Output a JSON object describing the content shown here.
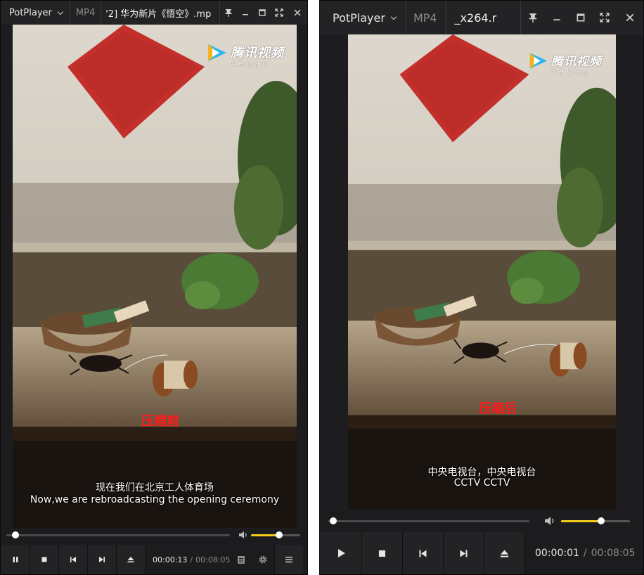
{
  "colors": {
    "accent_volume": "#f2cc1a",
    "note_text": "#ff1a1a",
    "frame_bg": "#1d1d1f"
  },
  "player_left": {
    "app_menu_label": "PotPlayer",
    "tab_format": "MP4",
    "tab_title": "'2] 华为新片《悟空》.mp",
    "watermark_brand": "腾讯视频",
    "watermark_slogan": "不负好时光",
    "note": "压缩前",
    "subtitle_zh": "现在我们在北京工人体育场",
    "subtitle_en": "Now,we are rebroadcasting the opening ceremony",
    "time_current": "00:00:13",
    "time_separator": "/",
    "time_duration": "00:08:05",
    "seek_progress": 0.03,
    "volume_level": 0.6,
    "playback_state": "playing",
    "icons": [
      "pin-icon",
      "minimize-icon",
      "maximize-icon",
      "fullscreen-icon",
      "close-icon",
      "pause-icon",
      "stop-icon",
      "previous-icon",
      "next-icon",
      "eject-icon",
      "playlist-icon",
      "gear-icon",
      "menu-icon",
      "volume-icon"
    ]
  },
  "player_right": {
    "app_menu_label": "PotPlayer",
    "tab_format": "MP4",
    "tab_title": "_x264.r",
    "watermark_brand": "腾讯视频",
    "watermark_slogan": "不负好时光",
    "note": "压缩后",
    "subtitle_zh": "中央电视台，中央电视台",
    "subtitle_en": "CCTV CCTV",
    "time_current": "00:00:01",
    "time_separator": "/",
    "time_duration": "00:08:05",
    "seek_progress": 0.01,
    "volume_level": 0.6,
    "playback_state": "paused",
    "icons": [
      "pin-icon",
      "minimize-icon",
      "maximize-icon",
      "fullscreen-icon",
      "close-icon",
      "play-icon",
      "stop-icon",
      "previous-icon",
      "next-icon",
      "eject-icon",
      "volume-icon"
    ]
  }
}
